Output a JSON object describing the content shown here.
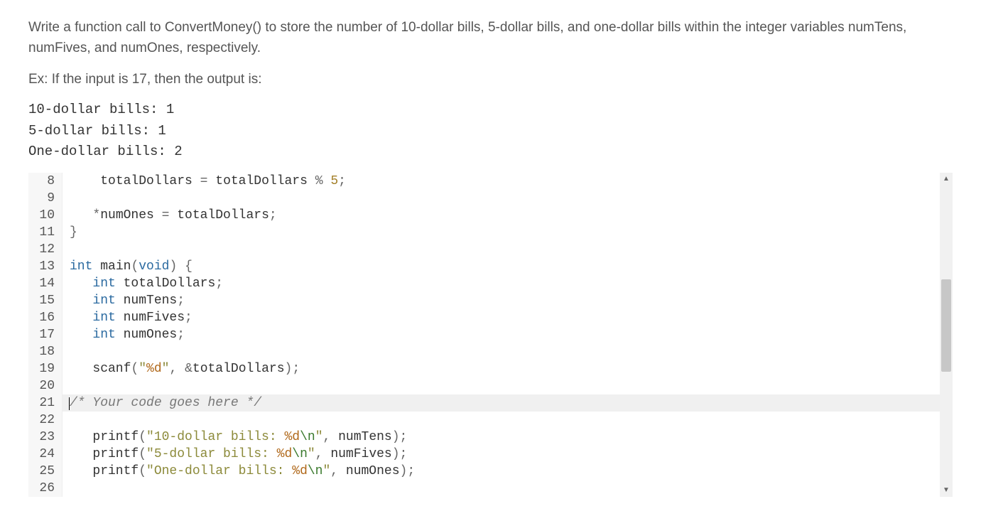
{
  "problem": {
    "prompt_part1": "Write a function call to ConvertMoney() to store the number of 10-dollar bills, 5-dollar bills, and one-dollar bills within the integer variables numTens, numFives, and numOnes, respectively.",
    "example_intro": "Ex: If the input is 17, then the output is:",
    "example_output_lines": [
      "10-dollar bills: 1",
      "5-dollar bills: 1",
      "One-dollar bills: 2"
    ]
  },
  "editor": {
    "first_line_no": 8,
    "active_line_no": 21,
    "lines": [
      {
        "no": 8,
        "indent": "    ",
        "tokens": [
          {
            "cls": "tok-plain",
            "t": "totalDollars "
          },
          {
            "cls": "tok-op",
            "t": "= "
          },
          {
            "cls": "tok-plain",
            "t": "totalDollars "
          },
          {
            "cls": "tok-op",
            "t": "% "
          },
          {
            "cls": "tok-num",
            "t": "5"
          },
          {
            "cls": "tok-punc",
            "t": ";"
          }
        ]
      },
      {
        "no": 9,
        "indent": "",
        "tokens": []
      },
      {
        "no": 10,
        "indent": "   ",
        "tokens": [
          {
            "cls": "tok-op",
            "t": "*"
          },
          {
            "cls": "tok-plain",
            "t": "numOnes "
          },
          {
            "cls": "tok-op",
            "t": "= "
          },
          {
            "cls": "tok-plain",
            "t": "totalDollars"
          },
          {
            "cls": "tok-punc",
            "t": ";"
          }
        ]
      },
      {
        "no": 11,
        "indent": "",
        "tokens": [
          {
            "cls": "tok-brace",
            "t": "}"
          }
        ]
      },
      {
        "no": 12,
        "indent": "",
        "tokens": []
      },
      {
        "no": 13,
        "indent": "",
        "tokens": [
          {
            "cls": "tok-type",
            "t": "int "
          },
          {
            "cls": "tok-plain",
            "t": "main"
          },
          {
            "cls": "tok-punc",
            "t": "("
          },
          {
            "cls": "tok-type",
            "t": "void"
          },
          {
            "cls": "tok-punc",
            "t": ") "
          },
          {
            "cls": "tok-brace",
            "t": "{"
          }
        ]
      },
      {
        "no": 14,
        "indent": "   ",
        "tokens": [
          {
            "cls": "tok-type",
            "t": "int "
          },
          {
            "cls": "tok-plain",
            "t": "totalDollars"
          },
          {
            "cls": "tok-punc",
            "t": ";"
          }
        ]
      },
      {
        "no": 15,
        "indent": "   ",
        "tokens": [
          {
            "cls": "tok-type",
            "t": "int "
          },
          {
            "cls": "tok-plain",
            "t": "numTens"
          },
          {
            "cls": "tok-punc",
            "t": ";"
          }
        ]
      },
      {
        "no": 16,
        "indent": "   ",
        "tokens": [
          {
            "cls": "tok-type",
            "t": "int "
          },
          {
            "cls": "tok-plain",
            "t": "numFives"
          },
          {
            "cls": "tok-punc",
            "t": ";"
          }
        ]
      },
      {
        "no": 17,
        "indent": "   ",
        "tokens": [
          {
            "cls": "tok-type",
            "t": "int "
          },
          {
            "cls": "tok-plain",
            "t": "numOnes"
          },
          {
            "cls": "tok-punc",
            "t": ";"
          }
        ]
      },
      {
        "no": 18,
        "indent": "",
        "tokens": []
      },
      {
        "no": 19,
        "indent": "   ",
        "tokens": [
          {
            "cls": "tok-plain",
            "t": "scanf"
          },
          {
            "cls": "tok-punc",
            "t": "("
          },
          {
            "cls": "tok-str",
            "t": "\""
          },
          {
            "cls": "tok-fmt",
            "t": "%d"
          },
          {
            "cls": "tok-str",
            "t": "\""
          },
          {
            "cls": "tok-punc",
            "t": ", "
          },
          {
            "cls": "tok-op",
            "t": "&"
          },
          {
            "cls": "tok-plain",
            "t": "totalDollars"
          },
          {
            "cls": "tok-punc",
            "t": ");"
          }
        ]
      },
      {
        "no": 20,
        "indent": "",
        "tokens": []
      },
      {
        "no": 21,
        "indent": "",
        "tokens": [
          {
            "cls": "tok-comm",
            "t": "/* Your code goes here */"
          }
        ]
      },
      {
        "no": 22,
        "indent": "",
        "tokens": []
      },
      {
        "no": 23,
        "indent": "   ",
        "tokens": [
          {
            "cls": "tok-plain",
            "t": "printf"
          },
          {
            "cls": "tok-punc",
            "t": "("
          },
          {
            "cls": "tok-str",
            "t": "\"10-dollar bills: "
          },
          {
            "cls": "tok-fmt",
            "t": "%d"
          },
          {
            "cls": "tok-esc",
            "t": "\\n"
          },
          {
            "cls": "tok-str",
            "t": "\""
          },
          {
            "cls": "tok-punc",
            "t": ", "
          },
          {
            "cls": "tok-plain",
            "t": "numTens"
          },
          {
            "cls": "tok-punc",
            "t": ");"
          }
        ]
      },
      {
        "no": 24,
        "indent": "   ",
        "tokens": [
          {
            "cls": "tok-plain",
            "t": "printf"
          },
          {
            "cls": "tok-punc",
            "t": "("
          },
          {
            "cls": "tok-str",
            "t": "\"5-dollar bills: "
          },
          {
            "cls": "tok-fmt",
            "t": "%d"
          },
          {
            "cls": "tok-esc",
            "t": "\\n"
          },
          {
            "cls": "tok-str",
            "t": "\""
          },
          {
            "cls": "tok-punc",
            "t": ", "
          },
          {
            "cls": "tok-plain",
            "t": "numFives"
          },
          {
            "cls": "tok-punc",
            "t": ");"
          }
        ]
      },
      {
        "no": 25,
        "indent": "   ",
        "tokens": [
          {
            "cls": "tok-plain",
            "t": "printf"
          },
          {
            "cls": "tok-punc",
            "t": "("
          },
          {
            "cls": "tok-str",
            "t": "\"One-dollar bills: "
          },
          {
            "cls": "tok-fmt",
            "t": "%d"
          },
          {
            "cls": "tok-esc",
            "t": "\\n"
          },
          {
            "cls": "tok-str",
            "t": "\""
          },
          {
            "cls": "tok-punc",
            "t": ", "
          },
          {
            "cls": "tok-plain",
            "t": "numOnes"
          },
          {
            "cls": "tok-punc",
            "t": ");"
          }
        ]
      },
      {
        "no": 26,
        "indent": "",
        "tokens": []
      }
    ]
  }
}
